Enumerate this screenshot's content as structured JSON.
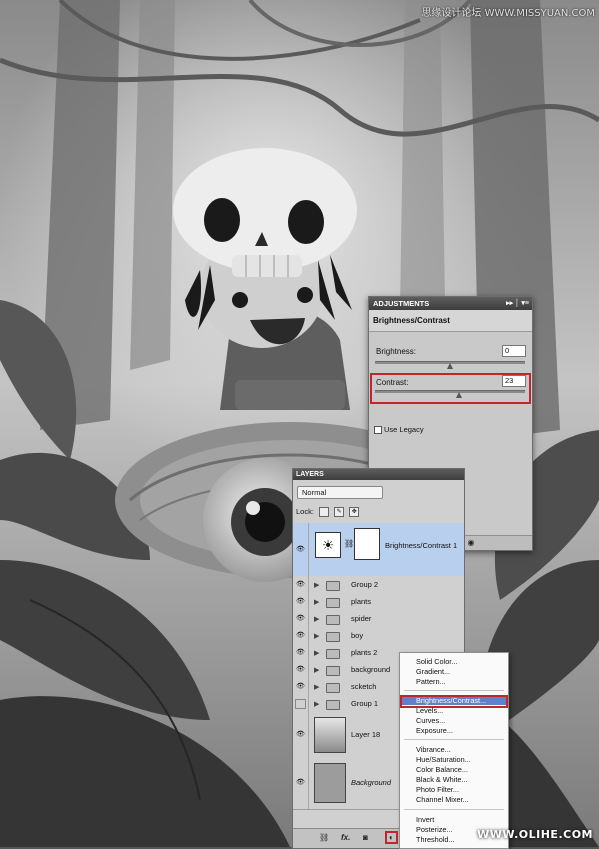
{
  "watermark_top": "思缘设计论坛 WWW.MISSYUAN.COM",
  "watermark_bottom": "WWW.OLIHE.COM",
  "adjustments": {
    "panel_title": "ADJUSTMENTS",
    "heading": "Brightness/Contrast",
    "brightness_label": "Brightness:",
    "brightness_value": "0",
    "contrast_label": "Contrast:",
    "contrast_value": "23",
    "legacy_label": "Use Legacy",
    "brightness_pct": 0.5,
    "contrast_pct": 0.56,
    "highlight_color": "#c0272d"
  },
  "layers": {
    "panel_title": "LAYERS",
    "blend_mode": "Normal",
    "lock_label": "Lock:",
    "items": [
      {
        "name": "Brightness/Contrast 1",
        "type": "adjustment",
        "selected": true
      },
      {
        "name": "Group 2",
        "type": "group"
      },
      {
        "name": "plants",
        "type": "group"
      },
      {
        "name": "spider",
        "type": "group"
      },
      {
        "name": "boy",
        "type": "group"
      },
      {
        "name": "plants 2",
        "type": "group"
      },
      {
        "name": "background",
        "type": "group"
      },
      {
        "name": "scketch",
        "type": "group"
      },
      {
        "name": "Group 1",
        "type": "group",
        "hidden": true
      },
      {
        "name": "Layer 18",
        "type": "layer"
      },
      {
        "name": "Background",
        "type": "layer",
        "italic": true
      }
    ]
  },
  "menu": {
    "items": [
      "Solid Color...",
      "Gradient...",
      "Pattern...",
      "Brightness/Contrast...",
      "Levels...",
      "Curves...",
      "Exposure...",
      "Vibrance...",
      "Hue/Saturation...",
      "Color Balance...",
      "Black & White...",
      "Photo Filter...",
      "Channel Mixer...",
      "Invert",
      "Posterize...",
      "Threshold..."
    ],
    "highlighted": "Brightness/Contrast...",
    "highlight_color": "#5d83c6"
  }
}
